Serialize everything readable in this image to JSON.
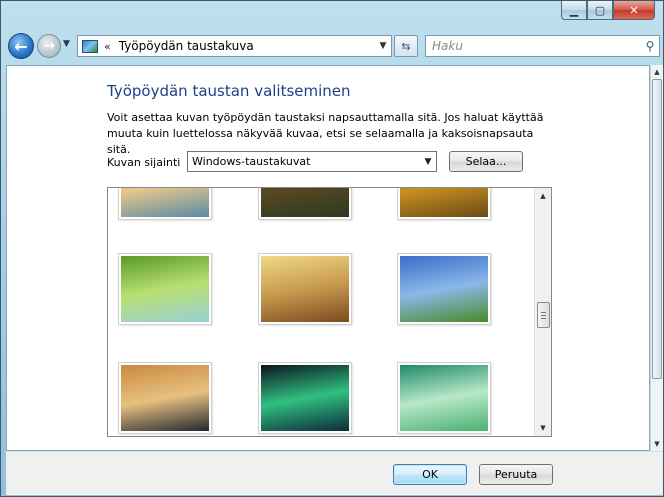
{
  "window": {
    "caption": {
      "minimize_glyph": "▁",
      "maximize_glyph": "▢",
      "close_glyph": "✕"
    }
  },
  "navbar": {
    "back_glyph": "←",
    "forward_glyph": "→",
    "history_glyph": "▼",
    "address": {
      "chevron": "«",
      "path": "Työpöydän taustakuva",
      "dropdown_glyph": "▼",
      "icon": "desktop-background-icon"
    },
    "refresh_glyph": "⇆",
    "search": {
      "placeholder": "Haku",
      "icon": "magnifier-icon",
      "icon_glyph": "⚲"
    }
  },
  "main": {
    "heading": "Työpöydän taustan valitseminen",
    "description": "Voit asettaa kuvan työpöydän taustaksi napsauttamalla sitä. Jos haluat käyttää muuta kuin luettelossa näkyvää kuvaa, etsi se selaamalla ja kaksoisnapsauta sitä.",
    "location_label": "Kuvan sijainti",
    "location_value": "Windows-taustakuvat",
    "location_dropdown_glyph": "▼",
    "browse_label": "Selaa...",
    "gallery": {
      "scroll_up_glyph": "▲",
      "scroll_down_glyph": "▼",
      "thumbnails": [
        {
          "name": "wallpaper-lake-sunset",
          "colors": [
            "#c89a54",
            "#e8c888",
            "#5a8aa8"
          ]
        },
        {
          "name": "wallpaper-dark-landscape",
          "colors": [
            "#1e2a18",
            "#584820",
            "#2e3a22"
          ]
        },
        {
          "name": "wallpaper-golden-dusk",
          "colors": [
            "#3a2a10",
            "#c8901e",
            "#6a4a16"
          ]
        },
        {
          "name": "wallpaper-palm-leaf",
          "colors": [
            "#5a9a2a",
            "#b8e070",
            "#9ad0d8"
          ]
        },
        {
          "name": "wallpaper-grass-sunset",
          "colors": [
            "#f0d888",
            "#c89a50",
            "#7a4a1e"
          ]
        },
        {
          "name": "wallpaper-green-hills",
          "colors": [
            "#3a6cc8",
            "#8ab8e8",
            "#4a8a2a"
          ]
        },
        {
          "name": "wallpaper-rock-lake",
          "colors": [
            "#c88a40",
            "#e8c080",
            "#222830"
          ]
        },
        {
          "name": "wallpaper-aurora",
          "colors": [
            "#0a1420",
            "#30c080",
            "#0e2a3a"
          ]
        },
        {
          "name": "wallpaper-vista-aurora",
          "colors": [
            "#1e8a6a",
            "#b8e8c8",
            "#4ab070"
          ]
        }
      ]
    }
  },
  "footer": {
    "ok_label": "OK",
    "cancel_label": "Peruuta"
  },
  "colors": {
    "heading": "#1e3f8a",
    "accent_button_border": "#3c7fb1"
  }
}
